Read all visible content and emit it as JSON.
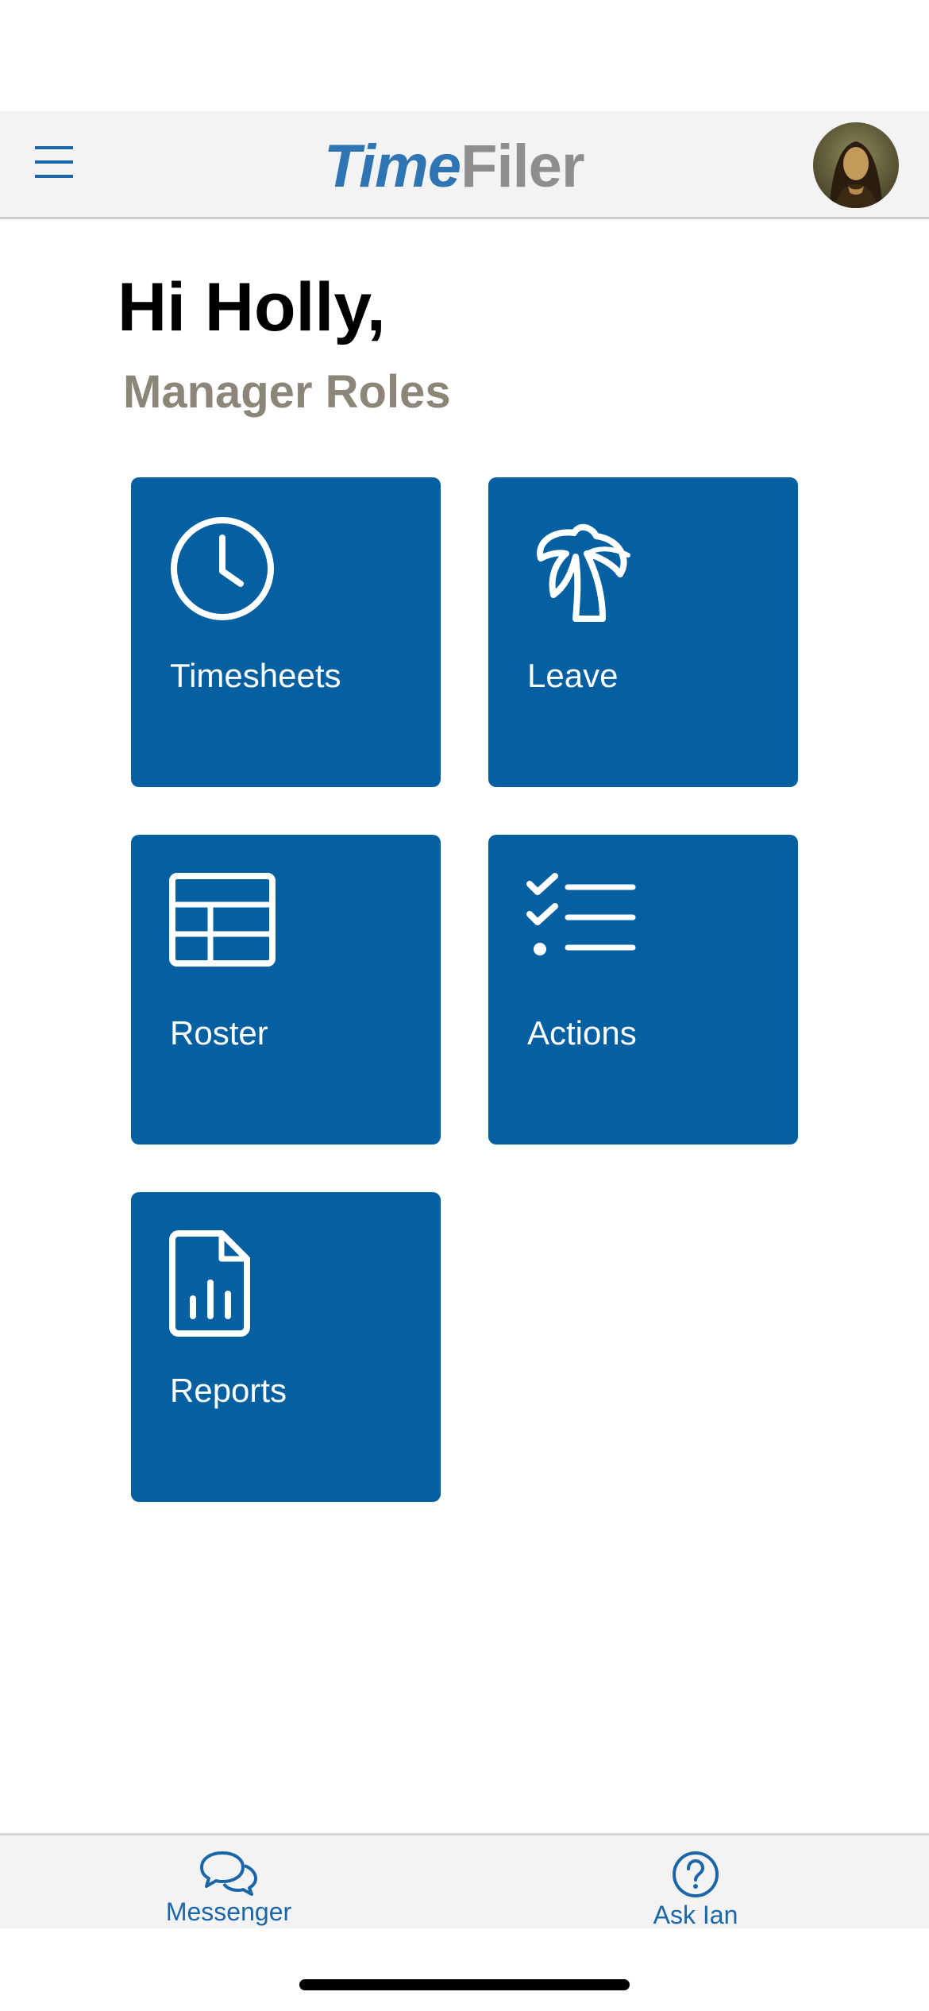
{
  "header": {
    "logo_part_1": "Time",
    "logo_part_2": "Filer",
    "menu_icon": "hamburger-menu-icon",
    "avatar_icon": "user-avatar"
  },
  "main": {
    "greeting": "Hi Holly,",
    "subtitle": "Manager Roles",
    "tiles": [
      {
        "label": "Timesheets",
        "icon": "clock-icon"
      },
      {
        "label": "Leave",
        "icon": "palm-tree-icon"
      },
      {
        "label": "Roster",
        "icon": "table-grid-icon"
      },
      {
        "label": "Actions",
        "icon": "checklist-icon"
      },
      {
        "label": "Reports",
        "icon": "report-document-icon"
      }
    ]
  },
  "tab_bar": {
    "items": [
      {
        "label": "Messenger",
        "icon": "chat-bubbles-icon"
      },
      {
        "label": "Ask Ian",
        "icon": "question-circle-icon"
      }
    ]
  },
  "colors": {
    "accent": "#0560a2",
    "logo_blue": "#2f74b3",
    "logo_gray": "#8e8e8e",
    "subtitle_gray": "#8b8678",
    "tab_text": "#1a66a8"
  }
}
